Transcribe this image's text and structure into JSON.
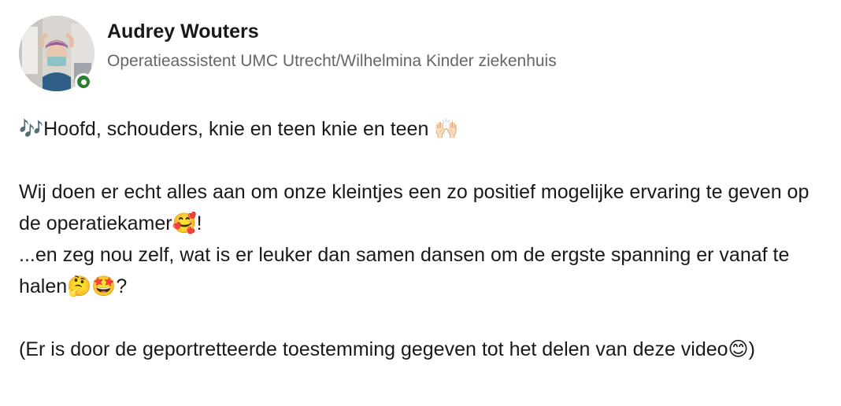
{
  "author": {
    "name": "Audrey Wouters",
    "headline": "Operatieassistent UMC Utrecht/Wilhelmina Kinder ziekenhuis",
    "presence": "online"
  },
  "post": {
    "line1": "🎶Hoofd, schouders, knie en teen knie en teen 🙌🏻",
    "line2": "Wij doen er echt alles aan om onze kleintjes een zo positief mogelijke ervaring te geven op de operatiekamer🥰!",
    "line3": "...en zeg nou zelf, wat is er leuker dan samen dansen om de ergste spanning er vanaf te halen🤔🤩?",
    "line4": "(Er is door de geportretteerde toestemming gegeven tot het delen van deze video😊)"
  },
  "colors": {
    "name": "#191919",
    "headline": "#666666",
    "presence": "#2e7d32"
  }
}
